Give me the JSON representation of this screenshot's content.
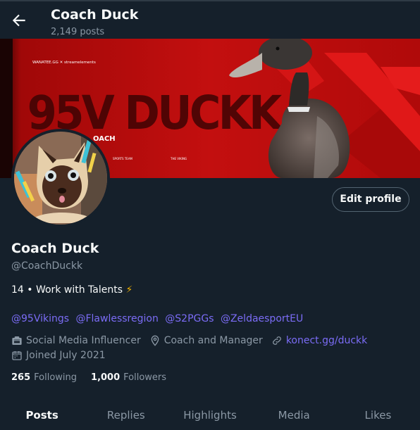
{
  "header": {
    "title": "Coach Duck",
    "post_count": "2,149 posts"
  },
  "banner": {
    "sponsor_text": "WANATEE.GG ✕ streamelements",
    "headline": "95V DUCKK",
    "role_text": "OACH",
    "small_left": "SPORTS TEAM",
    "small_right": "THE VIKING"
  },
  "profile": {
    "edit_label": "Edit profile",
    "name": "Coach Duck",
    "handle": "@CoachDuckk",
    "bio": "14 • Work with Talents",
    "bio_emoji": "⚡",
    "mentions": [
      "@95Vikings",
      "@Flawlessregion",
      "@S2PGGs",
      "@ZeldaesportEU"
    ],
    "category": "Social Media Influencer",
    "location": "Coach and Manager",
    "website": "konect.gg/duckk",
    "joined": "Joined July 2021",
    "following_count": "265",
    "following_label": "Following",
    "followers_count": "1,000",
    "followers_label": "Followers"
  },
  "tabs": [
    "Posts",
    "Replies",
    "Highlights",
    "Media",
    "Likes"
  ],
  "active_tab": "Posts",
  "colors": {
    "background": "#15202b",
    "link": "#7b6cf6",
    "muted": "#8b98a5",
    "banner_red": "#c50f0f"
  }
}
